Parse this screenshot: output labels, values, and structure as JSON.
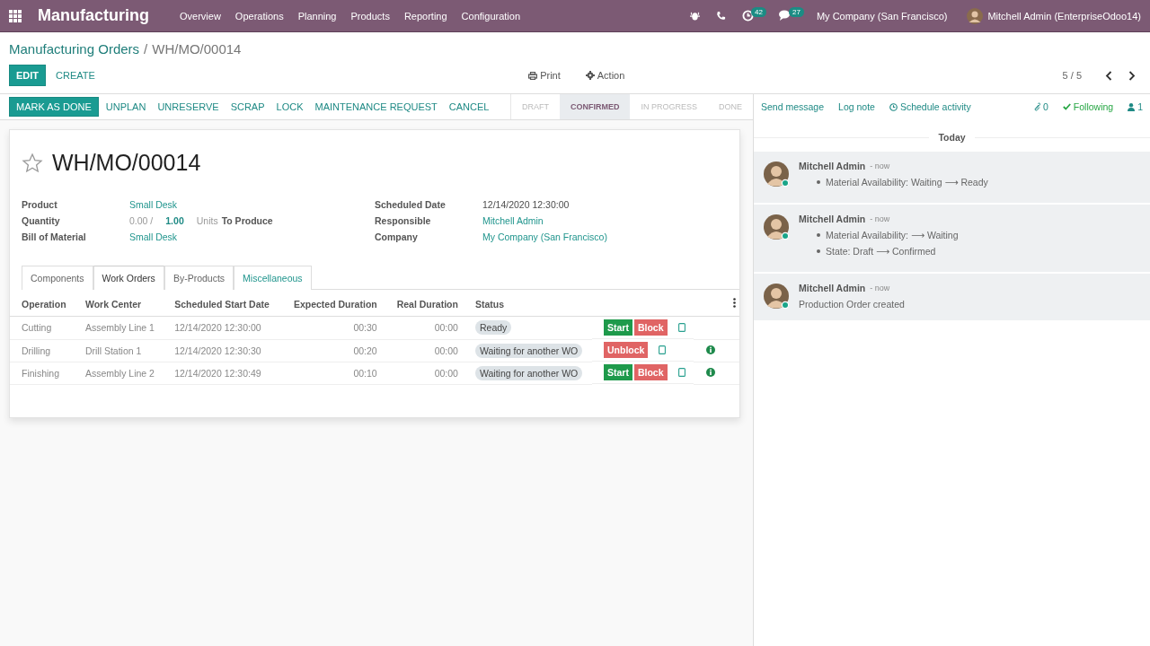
{
  "navbar": {
    "app_name": "Manufacturing",
    "menu": [
      "Overview",
      "Operations",
      "Planning",
      "Products",
      "Reporting",
      "Configuration"
    ],
    "activity_count": "42",
    "message_count": "27",
    "company": "My Company (San Francisco)",
    "user": "Mitchell Admin (EnterpriseOdoo14)"
  },
  "breadcrumb": {
    "parent": "Manufacturing Orders",
    "separator": "/",
    "current": "WH/MO/00014"
  },
  "control": {
    "primary": "EDIT",
    "secondary": "CREATE",
    "print": "Print",
    "action": "Action",
    "pager": "5 / 5"
  },
  "actions": [
    {
      "label": "MARK AS DONE",
      "kind": "primary"
    },
    {
      "label": "UNPLAN",
      "kind": "link"
    },
    {
      "label": "UNRESERVE",
      "kind": "link"
    },
    {
      "label": "SCRAP",
      "kind": "link"
    },
    {
      "label": "LOCK",
      "kind": "link"
    },
    {
      "label": "MAINTENANCE REQUEST",
      "kind": "link"
    },
    {
      "label": "CANCEL",
      "kind": "link"
    }
  ],
  "stages": [
    {
      "label": "DRAFT",
      "selected": false
    },
    {
      "label": "CONFIRMED",
      "selected": true
    },
    {
      "label": "IN PROGRESS",
      "selected": false
    },
    {
      "label": "DONE",
      "selected": false
    }
  ],
  "chatter_bar": {
    "send": "Send message",
    "log": "Log note",
    "schedule": "Schedule activity",
    "attachments": "0",
    "following": "Following",
    "followers": "1"
  },
  "form": {
    "title": "WH/MO/00014",
    "starred": false,
    "left_fields": [
      {
        "label": "Product",
        "kind": "link",
        "value": "Small Desk"
      },
      {
        "label": "Quantity",
        "kind": "quantity",
        "produced": "0.00 /",
        "qty": "1.00",
        "unit": "Units",
        "suffix": "To Produce"
      },
      {
        "label": "Bill of Material",
        "kind": "link",
        "value": "Small Desk"
      }
    ],
    "right_fields": [
      {
        "label": "Scheduled Date",
        "kind": "text",
        "value": "12/14/2020 12:30:00"
      },
      {
        "label": "Responsible",
        "kind": "link",
        "value": "Mitchell Admin"
      },
      {
        "label": "Company",
        "kind": "link",
        "value": "My Company (San Francisco)"
      }
    ]
  },
  "tabs": [
    {
      "label": "Components",
      "selected": false
    },
    {
      "label": "Work Orders",
      "selected": true
    },
    {
      "label": "By-Products",
      "selected": false
    },
    {
      "label": "Miscellaneous",
      "selected": false
    }
  ],
  "table": {
    "columns": [
      "Operation",
      "Work Center",
      "Scheduled Start Date",
      "Expected Duration",
      "Real Duration",
      "Status"
    ],
    "rows": [
      {
        "operation": "Cutting",
        "work_center": "Assembly Line 1",
        "start": "12/14/2020 12:30:00",
        "expected": "00:30",
        "real": "00:00",
        "status": "Ready",
        "buttons": [
          {
            "label": "Start",
            "kind": "start"
          },
          {
            "label": "Block",
            "kind": "block"
          }
        ],
        "info": false
      },
      {
        "operation": "Drilling",
        "work_center": "Drill Station 1",
        "start": "12/14/2020 12:30:30",
        "expected": "00:20",
        "real": "00:00",
        "status": "Waiting for another WO",
        "buttons": [
          {
            "label": "Unblock",
            "kind": "block"
          }
        ],
        "info": true
      },
      {
        "operation": "Finishing",
        "work_center": "Assembly Line 2",
        "start": "12/14/2020 12:30:49",
        "expected": "00:10",
        "real": "00:00",
        "status": "Waiting for another WO",
        "buttons": [
          {
            "label": "Start",
            "kind": "start"
          },
          {
            "label": "Block",
            "kind": "block"
          }
        ],
        "info": true
      }
    ]
  },
  "chatter": {
    "date": "Today",
    "messages": [
      {
        "author": "Mitchell Admin",
        "time": "- now",
        "kind": "tracking",
        "lines": [
          "Material Availability: Waiting ⟶ Ready"
        ]
      },
      {
        "author": "Mitchell Admin",
        "time": "- now",
        "kind": "tracking",
        "lines": [
          "Material Availability:  ⟶ Waiting",
          "State: Draft ⟶ Confirmed"
        ]
      },
      {
        "author": "Mitchell Admin",
        "time": "- now",
        "kind": "text",
        "lines": [
          "Production Order created"
        ]
      }
    ]
  }
}
